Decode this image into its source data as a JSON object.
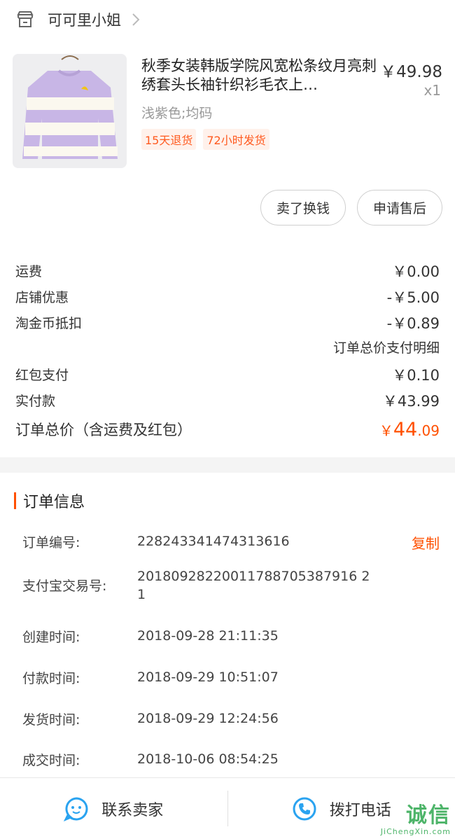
{
  "store": {
    "name": "可可里小姐"
  },
  "product": {
    "title": "秋季女装韩版学院风宽松条纹月亮刺绣套头长袖针织衫毛衣上…",
    "price": "￥49.98",
    "quantity": "x1",
    "sku": "浅紫色;均码",
    "tags": [
      "15天退货",
      "72小时发货"
    ]
  },
  "actions": {
    "sell": "卖了换钱",
    "after_sale": "申请售后"
  },
  "fees": {
    "shipping_label": "运费",
    "shipping_value": "￥0.00",
    "store_discount_label": "店铺优惠",
    "store_discount_value": "-￥5.00",
    "coin_label": "淘金币抵扣",
    "coin_value": "-￥0.89",
    "detail_link": "订单总价支付明细",
    "redpacket_label": "红包支付",
    "redpacket_value": "￥0.10",
    "paid_label": "实付款",
    "paid_value": "￥43.99",
    "total_label": "订单总价（含运费及红包）",
    "total_currency": "￥",
    "total_int": "44",
    "total_dec": ".09"
  },
  "order_info": {
    "title": "订单信息",
    "copy": "复制",
    "rows": [
      {
        "label": "订单编号:",
        "value": "228243341474313616"
      },
      {
        "label": "支付宝交易号:",
        "value": "20180928220011788705387916 21"
      },
      {
        "label": "创建时间:",
        "value": "2018-09-28 21:11:35"
      },
      {
        "label": "付款时间:",
        "value": "2018-09-29 10:51:07"
      },
      {
        "label": "发货时间:",
        "value": "2018-09-29 12:24:56"
      },
      {
        "label": "成交时间:",
        "value": "2018-10-06 08:54:25"
      }
    ]
  },
  "bottom": {
    "contact_seller": "联系卖家",
    "call": "拨打电话"
  },
  "watermark": {
    "main": "诚信",
    "sub": "JiChengXin.com"
  },
  "colors": {
    "accent": "#ff5000",
    "tag_bg": "#fff1eb",
    "icon_blue": "#2aa3f0",
    "product_purple": "#c8b6e6"
  },
  "icons": {
    "store": "store-icon",
    "chevron": "chevron-right-icon",
    "chat": "chat-icon",
    "phone": "phone-icon"
  }
}
